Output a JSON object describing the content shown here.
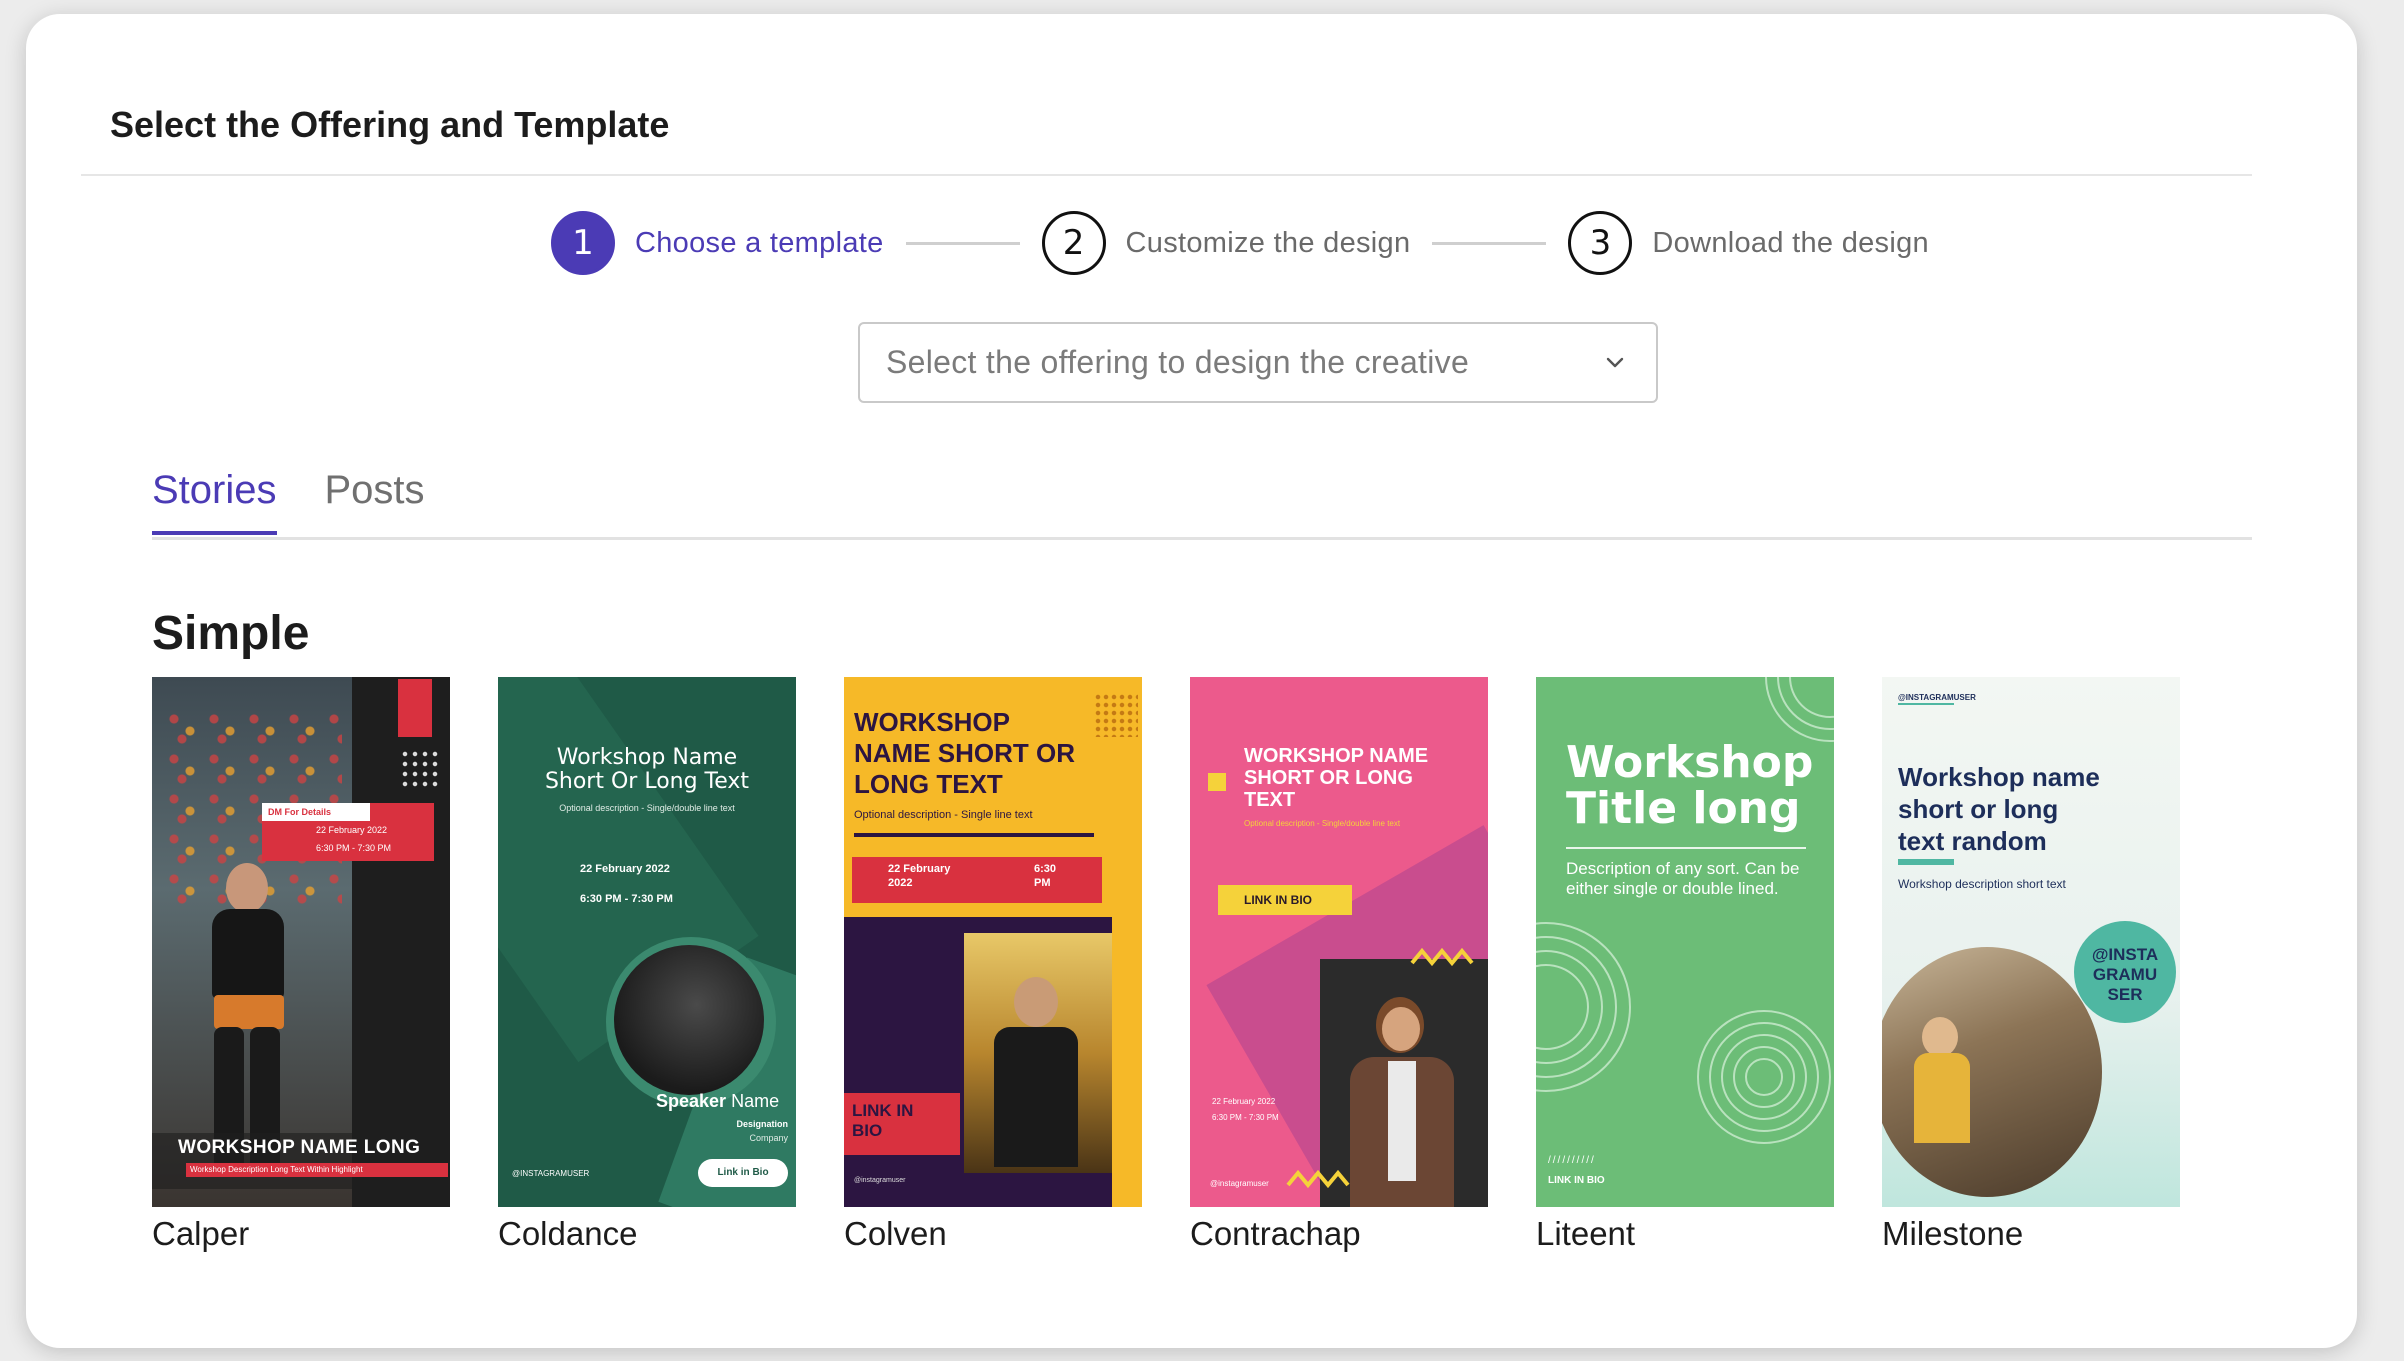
{
  "header": {
    "title": "Select the Offering and Template"
  },
  "stepper": {
    "steps": [
      {
        "number": "1",
        "label": "Choose a template",
        "state": "active"
      },
      {
        "number": "2",
        "label": "Customize the design",
        "state": "inactive"
      },
      {
        "number": "3",
        "label": "Download the design",
        "state": "inactive"
      }
    ]
  },
  "offering_select": {
    "placeholder": "Select the offering to design the creative",
    "icon": "chevron-down-icon"
  },
  "tabs": [
    {
      "label": "Stories",
      "active": true
    },
    {
      "label": "Posts",
      "active": false
    }
  ],
  "section": {
    "title": "Simple"
  },
  "templates": [
    {
      "name": "Calper",
      "thumb": {
        "badge": "DM For Details",
        "date": "22 February 2022",
        "time": "6:30 PM - 7:30 PM",
        "title": "WORKSHOP NAME LONG",
        "subtitle": "Workshop Description Long Text Within Highlight"
      }
    },
    {
      "name": "Coldance",
      "thumb": {
        "title_line1": "Workshop Name",
        "title_line2": "Short Or Long Text",
        "desc": "Optional description - Single/double line text",
        "date": "22 February 2022",
        "time": "6:30 PM - 7:30 PM",
        "speaker_bold": "Speaker",
        "speaker_rest": "Name",
        "designation": "Designation",
        "company": "Company",
        "handle": "@INSTAGRAMUSER",
        "button": "Link in Bio"
      }
    },
    {
      "name": "Colven",
      "thumb": {
        "title_line1": "WORKSHOP",
        "title_line2": "NAME SHORT OR",
        "title_line3": "LONG TEXT",
        "desc": "Optional description - Single line text",
        "date_line1": "22 February",
        "date_line2": "2022",
        "time_line1": "6:30",
        "time_line2": "PM",
        "link_line1": "LINK IN",
        "link_line2": "BIO",
        "handle": "@instagramuser"
      }
    },
    {
      "name": "Contrachap",
      "thumb": {
        "title_line1": "WORKSHOP NAME",
        "title_line2": "SHORT OR LONG",
        "title_line3": "TEXT",
        "desc": "Optional description - Single/double line text",
        "button": "LINK IN BIO",
        "date": "22 February 2022",
        "time": "6:30 PM - 7:30 PM",
        "handle": "@instagramuser"
      }
    },
    {
      "name": "Liteent",
      "thumb": {
        "title_line1": "Workshop",
        "title_line2": "Title long",
        "desc": "Description of any sort. Can be either single or double lined.",
        "link": "LINK IN BIO"
      }
    },
    {
      "name": "Milestone",
      "thumb": {
        "handle_top": "@INSTAGRAMUSER",
        "title_line1": "Workshop name",
        "title_line2": "short or long",
        "title_line3": "text random",
        "desc": "Workshop description short text",
        "badge_line1": "@INSTA",
        "badge_line2": "GRAMU",
        "badge_line3": "SER"
      }
    }
  ],
  "colors": {
    "accent": "#4b3bb5",
    "calper_red": "#d9313f",
    "coldance_green": "#1f5a47",
    "colven_yellow": "#f6b928",
    "contrachap_pink": "#ec5a8c",
    "liteent_green": "#6cbd77",
    "milestone_navy": "#1d2e5a"
  }
}
